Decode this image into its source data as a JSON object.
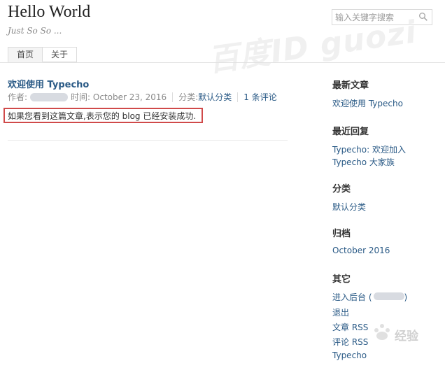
{
  "site": {
    "title": "Hello World",
    "description": "Just So So ..."
  },
  "search": {
    "placeholder": "输入关键字搜索"
  },
  "watermark": {
    "text": "百度ID guozi"
  },
  "nav": {
    "items": [
      {
        "label": "首页",
        "active": true
      },
      {
        "label": "关于",
        "active": false
      }
    ]
  },
  "post": {
    "title": "欢迎使用 Typecho",
    "author_label": "作者:",
    "time_label": "时间: October 23, 2016",
    "category_label": "分类:",
    "category": "默认分类",
    "comments": "1 条评论",
    "body": "如果您看到这篇文章,表示您的 blog 已经安装成功."
  },
  "sidebar": {
    "recent_posts": {
      "title": "最新文章",
      "items": [
        "欢迎使用 Typecho"
      ]
    },
    "recent_comments": {
      "title": "最近回复",
      "line1": "Typecho: 欢迎加入",
      "line2": "Typecho 大家族"
    },
    "categories": {
      "title": "分类",
      "items": [
        "默认分类"
      ]
    },
    "archives": {
      "title": "归档",
      "items": [
        "October 2016"
      ]
    },
    "other": {
      "title": "其它",
      "admin": "进入后台 (",
      "admin_close": ")",
      "logout": "退出",
      "posts_rss": "文章 RSS",
      "comments_rss": "评论 RSS",
      "typecho": "Typecho"
    }
  },
  "logo_watermark": {
    "text": "经验"
  },
  "colors": {
    "link": "#2a5a86",
    "highlight_border": "#d04a4a"
  }
}
